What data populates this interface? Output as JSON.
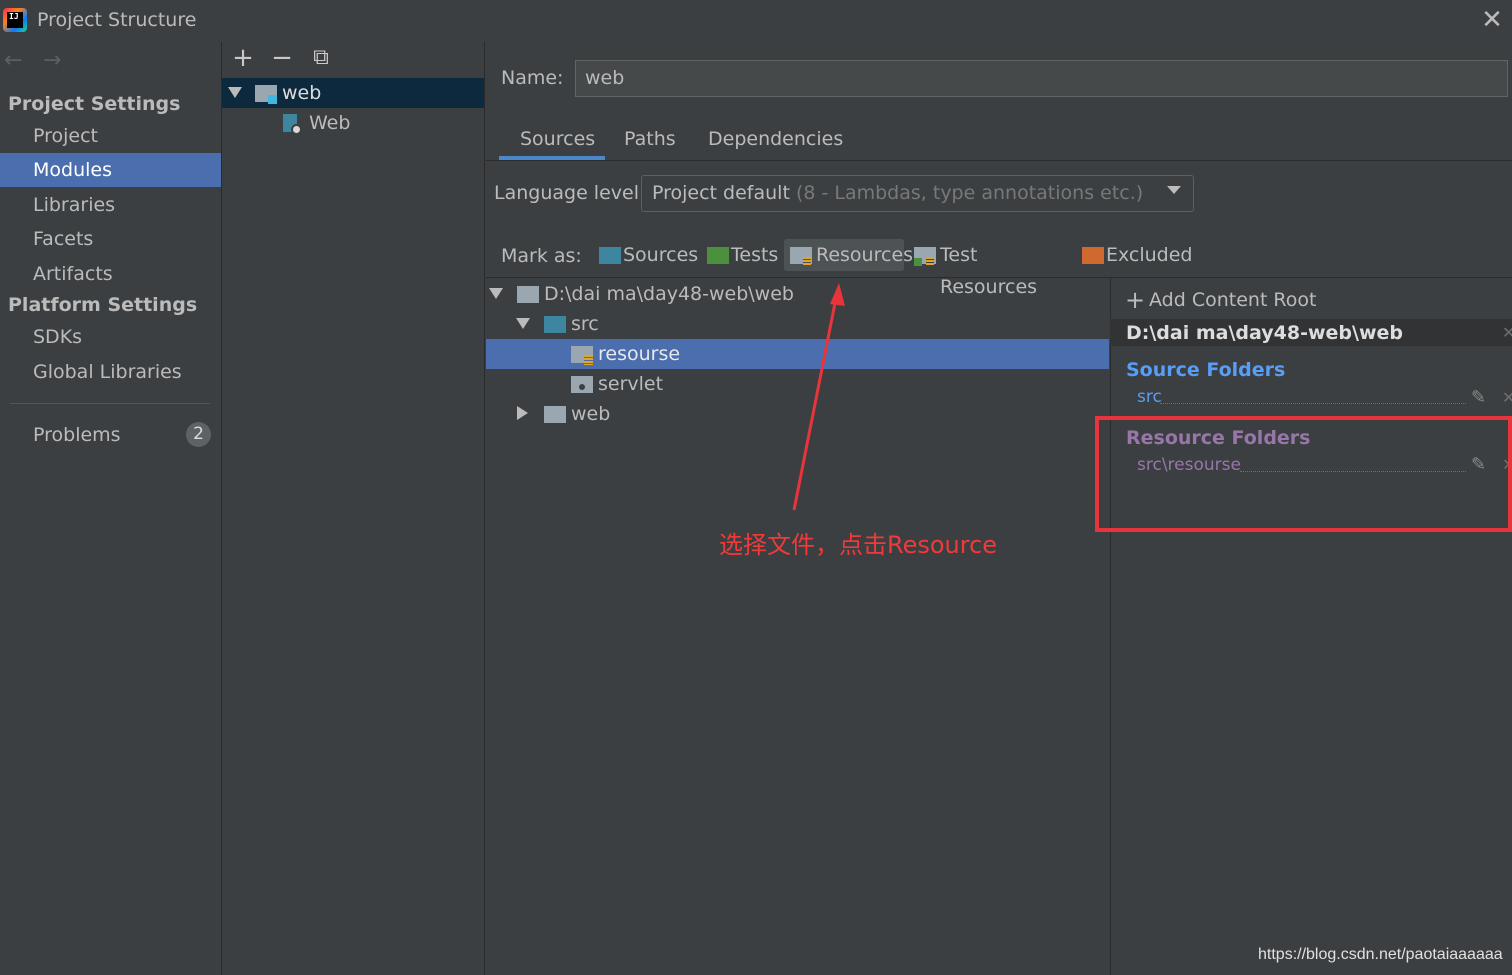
{
  "window": {
    "title": "Project Structure",
    "close_glyph": "✕"
  },
  "nav": {
    "back_glyph": "←",
    "forward_glyph": "→",
    "sections": [
      {
        "label": "Project Settings",
        "items": [
          "Project",
          "Modules",
          "Libraries",
          "Facets",
          "Artifacts"
        ]
      },
      {
        "label": "Platform Settings",
        "items": [
          "SDKs",
          "Global Libraries"
        ]
      }
    ],
    "selected_item": "Modules",
    "problems": {
      "label": "Problems",
      "count": "2"
    }
  },
  "modules": {
    "toolbar": {
      "add": "+",
      "remove": "−",
      "copy": "⧉"
    },
    "tree": [
      {
        "label": "web",
        "icon": "module-folder-icon",
        "expanded": true,
        "selected": true
      },
      {
        "label": "Web",
        "icon": "web-facet-icon"
      }
    ]
  },
  "module_settings": {
    "name_label": "Name:",
    "name_value": "web",
    "tabs": [
      "Sources",
      "Paths",
      "Dependencies"
    ],
    "active_tab": "Sources",
    "language_level_label": "Language level:",
    "language_level_value": "Project default",
    "language_level_hint": "(8 - Lambdas, type annotations etc.)",
    "mark_as_label": "Mark as:",
    "mark_as": [
      {
        "label": "Sources",
        "color": "#3e86a0"
      },
      {
        "label": "Tests",
        "color": "#4c8f3c"
      },
      {
        "label": "Resources",
        "color": "#9aa7b0",
        "active": true
      },
      {
        "label": "Test Resources",
        "color": "#9aa7b0"
      },
      {
        "label": "Excluded",
        "color": "#d0692f"
      }
    ]
  },
  "file_tree": [
    {
      "label": "D:\\dai ma\\day48-web\\web",
      "depth": 0,
      "expanded": true,
      "icon": "folder-icon"
    },
    {
      "label": "src",
      "depth": 1,
      "expanded": true,
      "icon": "source-folder-icon"
    },
    {
      "label": "resourse",
      "depth": 2,
      "selected": true,
      "icon": "resource-folder-icon"
    },
    {
      "label": "servlet",
      "depth": 2,
      "icon": "package-folder-icon"
    },
    {
      "label": "web",
      "depth": 1,
      "expanded": false,
      "icon": "folder-icon"
    }
  ],
  "content_root": {
    "add_label": "Add Content Root",
    "path": "D:\\dai ma\\day48-web\\web",
    "source_folders_title": "Source Folders",
    "source_folders": [
      "src"
    ],
    "resource_folders_title": "Resource Folders",
    "resource_folders": [
      "src\\resourse"
    ]
  },
  "colors": {
    "source_title": "#589df6",
    "resource_title": "#9876aa",
    "selection": "#4b6eaf",
    "annotation": "#e8343b"
  },
  "annotation": {
    "text": "选择文件，点击Resource"
  },
  "watermark": "https://blog.csdn.net/paotaiaaaaaa"
}
